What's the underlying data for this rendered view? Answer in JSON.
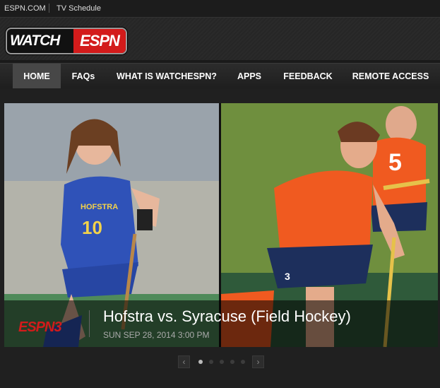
{
  "topbar": {
    "espn_link": "ESPN.COM",
    "tv_link": "TV Schedule"
  },
  "logo": {
    "watch": "WATCH",
    "espn": "ESPN"
  },
  "nav": {
    "items": [
      {
        "label": "HOME",
        "active": true
      },
      {
        "label": "FAQs",
        "active": false
      },
      {
        "label": "WHAT IS WATCHESPN?",
        "active": false
      },
      {
        "label": "APPS",
        "active": false
      },
      {
        "label": "FEEDBACK",
        "active": false
      },
      {
        "label": "REMOTE ACCESS",
        "active": false
      }
    ]
  },
  "hero": {
    "network": "ESPN3",
    "title": "Hofstra vs. Syracuse (Field Hockey)",
    "date": "SUN SEP 28, 2014 3:00 PM",
    "left_jersey": "10",
    "left_team": "HOFSTRA",
    "right_jersey_front": "3",
    "right_jersey_back": "5"
  },
  "pager": {
    "prev": "‹",
    "next": "›",
    "dots": 5,
    "active_dot": 1
  },
  "colors": {
    "espn_red": "#d31b1b",
    "hofstra_blue": "#2f52b8",
    "syracuse_orange": "#f05a20"
  }
}
